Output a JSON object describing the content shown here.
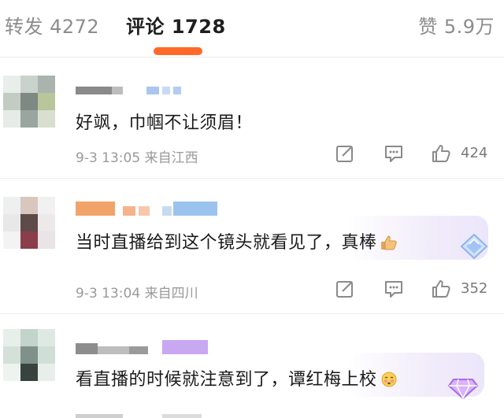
{
  "tabs": {
    "repost": "转发 4272",
    "comments": "评论 1728",
    "likes": "赞 5.9万"
  },
  "colors": {
    "accent": "#ff6a2b",
    "badge_purple": "#b77bf0"
  },
  "comments": [
    {
      "text": "好飒，巾帼不让须眉！",
      "time": "9-3 13:05",
      "location": "来自江西",
      "likes": "424"
    },
    {
      "text": "当时直播给到这个镜头就看见了，真棒",
      "emoji": "thumbs-up-emoji",
      "time": "9-3 13:04",
      "location": "来自四川",
      "likes": "352"
    },
    {
      "text": "看直播的时候就注意到了，谭红梅上校",
      "emoji": "shy-face-emoji"
    }
  ],
  "icons": [
    "edit-icon",
    "reply-icon",
    "like-icon",
    "diamond-badge-icon",
    "gem-badge-icon"
  ]
}
